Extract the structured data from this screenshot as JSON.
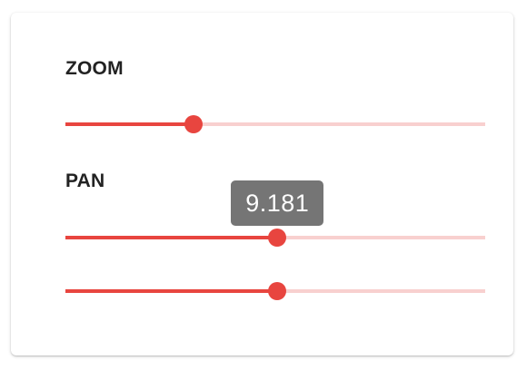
{
  "colors": {
    "accent": "#e8453f",
    "track_inactive": "#f8d0cf",
    "tooltip_bg": "#757575",
    "label_text": "#222222"
  },
  "zoom": {
    "label": "ZOOM",
    "fraction": 0.305
  },
  "pan": {
    "label": "PAN",
    "sliders": [
      {
        "fraction": 0.505,
        "tooltip": "9.181"
      },
      {
        "fraction": 0.505
      }
    ]
  }
}
